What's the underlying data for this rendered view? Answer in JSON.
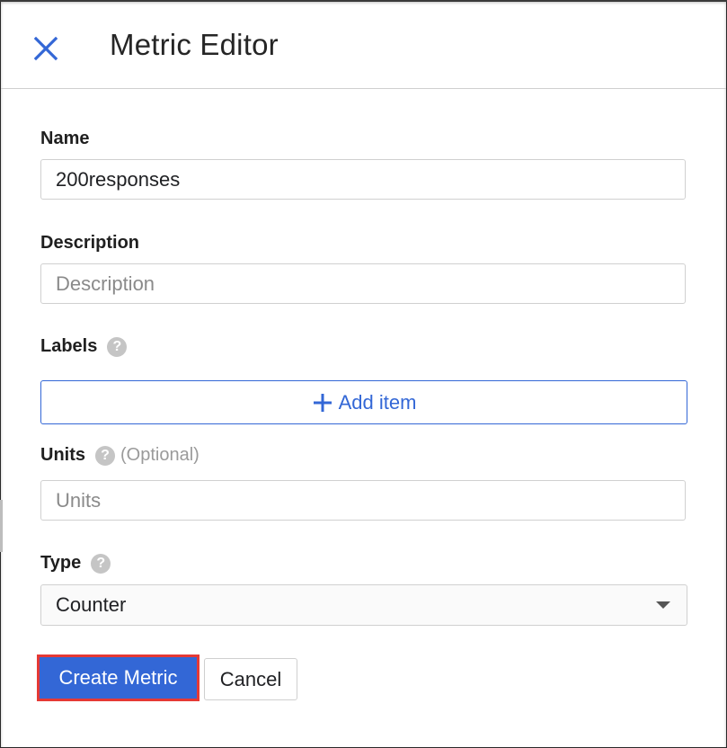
{
  "header": {
    "title": "Metric Editor"
  },
  "form": {
    "name": {
      "label": "Name",
      "value": "200responses"
    },
    "description": {
      "label": "Description",
      "placeholder": "Description"
    },
    "labels": {
      "label": "Labels",
      "add_item": "Add item"
    },
    "units": {
      "label": "Units",
      "optional": "(Optional)",
      "placeholder": "Units"
    },
    "type": {
      "label": "Type",
      "selected": "Counter"
    },
    "help_glyph": "?"
  },
  "actions": {
    "create": "Create Metric",
    "cancel": "Cancel"
  },
  "colors": {
    "accent": "#3367d6",
    "highlight": "#e53935"
  }
}
